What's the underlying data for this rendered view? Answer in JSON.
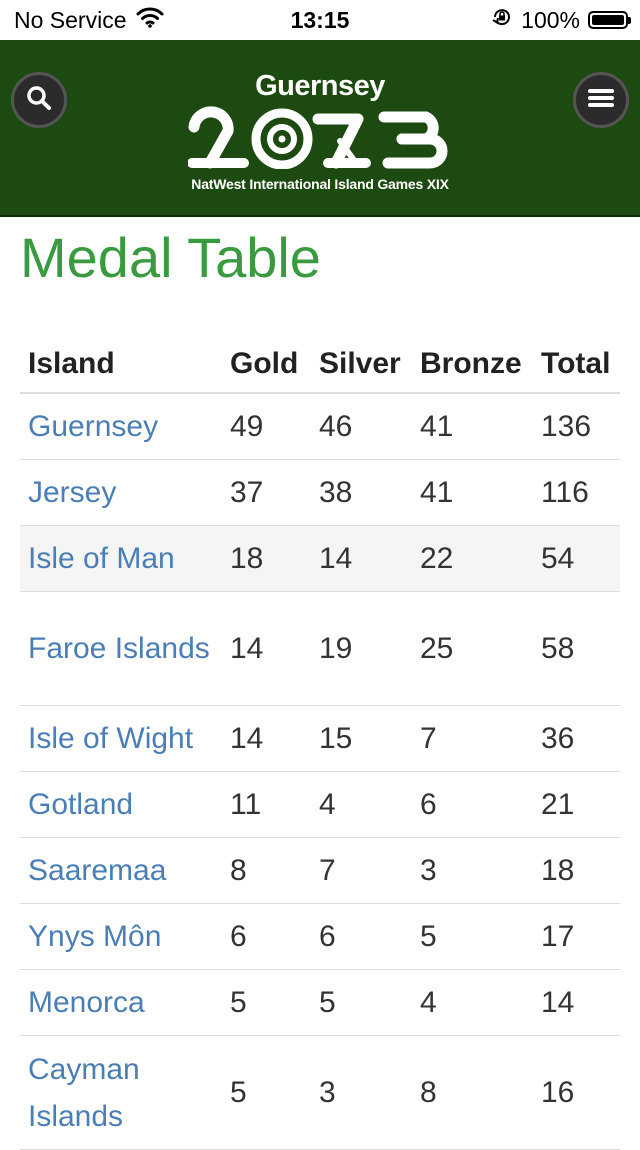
{
  "status_bar": {
    "carrier": "No Service",
    "time": "13:15",
    "battery": "100%",
    "battery_level": 1.0
  },
  "header": {
    "logo_title": "Guernsey",
    "logo_year": "2023",
    "logo_subtitle": "NatWest International Island Games XIX",
    "icons": {
      "search": "search-icon",
      "menu": "hamburger-menu-icon"
    }
  },
  "page": {
    "title": "Medal Table"
  },
  "table": {
    "columns": [
      "Island",
      "Gold",
      "Silver",
      "Bronze",
      "Total"
    ],
    "rows": [
      {
        "island": "Guernsey",
        "gold": "49",
        "silver": "46",
        "bronze": "41",
        "total": "136"
      },
      {
        "island": "Jersey",
        "gold": "37",
        "silver": "38",
        "bronze": "41",
        "total": "116"
      },
      {
        "island": "Isle of Man",
        "gold": "18",
        "silver": "14",
        "bronze": "22",
        "total": "54"
      },
      {
        "island": "Faroe Islands",
        "gold": "14",
        "silver": "19",
        "bronze": "25",
        "total": "58"
      },
      {
        "island": "Isle of Wight",
        "gold": "14",
        "silver": "15",
        "bronze": "7",
        "total": "36"
      },
      {
        "island": "Gotland",
        "gold": "11",
        "silver": "4",
        "bronze": "6",
        "total": "21"
      },
      {
        "island": "Saaremaa",
        "gold": "8",
        "silver": "7",
        "bronze": "3",
        "total": "18"
      },
      {
        "island": "Ynys Môn",
        "gold": "6",
        "silver": "6",
        "bronze": "5",
        "total": "17"
      },
      {
        "island": "Menorca",
        "gold": "5",
        "silver": "5",
        "bronze": "4",
        "total": "14"
      },
      {
        "island": "Cayman Islands",
        "gold": "5",
        "silver": "3",
        "bronze": "8",
        "total": "16"
      }
    ]
  },
  "colors": {
    "header_bg": "#1d4a10",
    "title_green": "#3a9a3f",
    "link_blue": "#4a7eb5"
  }
}
